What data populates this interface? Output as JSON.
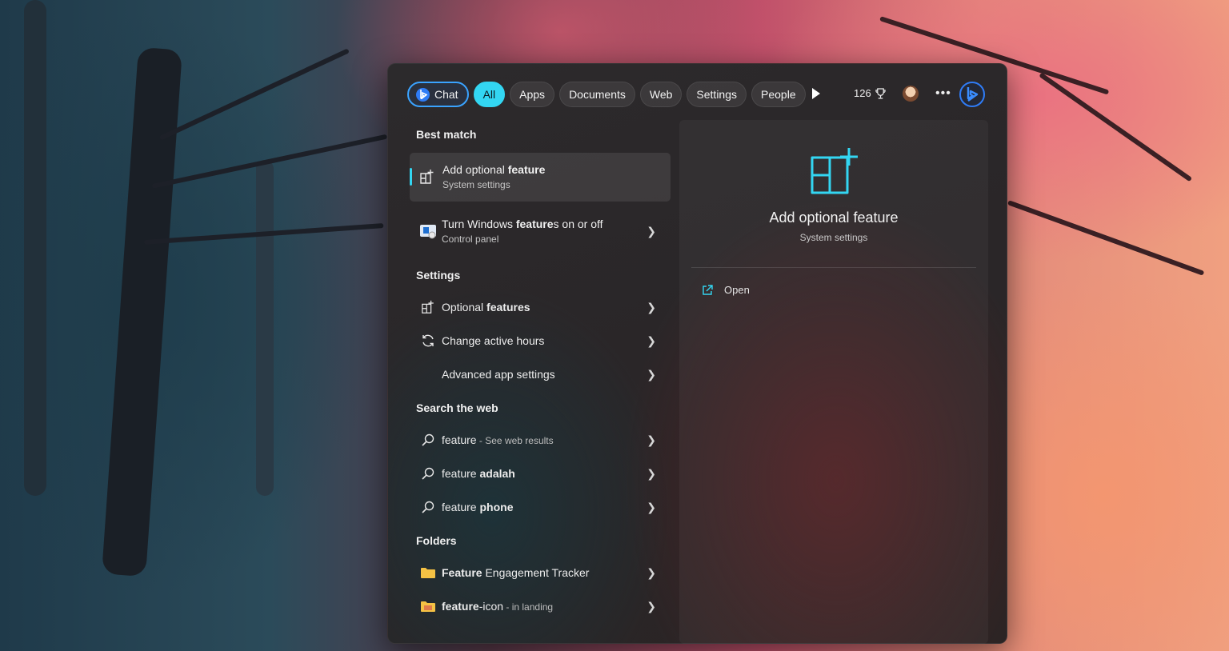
{
  "filters": {
    "chat": "Chat",
    "tabs": [
      "All",
      "Apps",
      "Documents",
      "Web",
      "Settings",
      "People"
    ],
    "active": "All",
    "points": "126"
  },
  "best_match": {
    "heading": "Best match",
    "title_plain": "Add optional ",
    "title_bold": "feature",
    "subtitle": "System settings"
  },
  "control_panel_item": {
    "title_pre": "Turn Windows ",
    "title_bold": "feature",
    "title_post": "s on or off",
    "subtitle": "Control panel"
  },
  "settings": {
    "heading": "Settings",
    "items": [
      {
        "pre": "Optional ",
        "bold": "features",
        "post": "",
        "icon": "optional-features-icon"
      },
      {
        "pre": "Change active hours",
        "bold": "",
        "post": "",
        "icon": "refresh-icon"
      },
      {
        "pre": "Advanced app settings",
        "bold": "",
        "post": "",
        "icon": ""
      }
    ]
  },
  "web": {
    "heading": "Search the web",
    "items": [
      {
        "pre": "feature",
        "bold": "",
        "suffix": " - See web results"
      },
      {
        "pre": "feature ",
        "bold": "adalah",
        "suffix": ""
      },
      {
        "pre": "feature ",
        "bold": "phone",
        "suffix": ""
      }
    ]
  },
  "folders": {
    "heading": "Folders",
    "items": [
      {
        "bold": "Feature",
        "post": " Engagement Tracker",
        "suffix": ""
      },
      {
        "bold": "feature",
        "post": "-icon",
        "suffix": " - in landing"
      }
    ]
  },
  "preview": {
    "title": "Add optional feature",
    "subtitle": "System settings",
    "open_label": "Open"
  },
  "colors": {
    "accent": "#33d6f2",
    "bing_blue": "#2f7cf6",
    "folder_yellow": "#f5c244"
  }
}
